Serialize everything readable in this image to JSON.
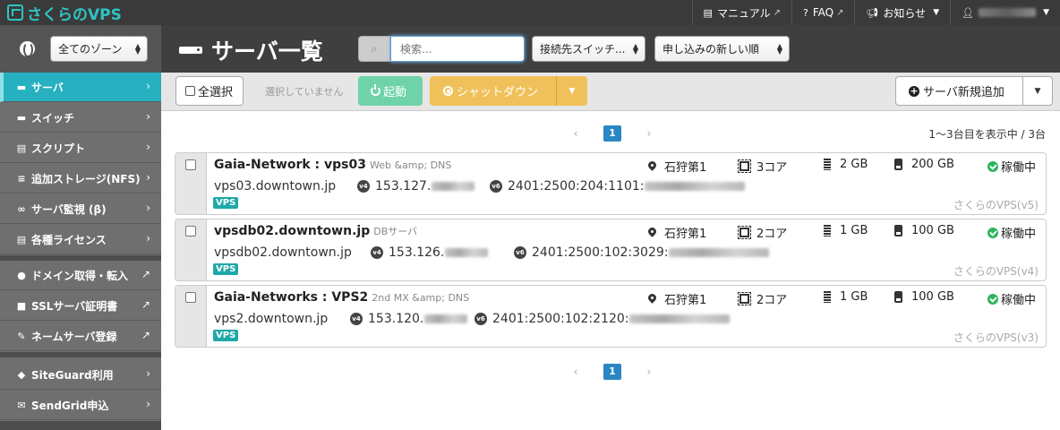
{
  "app": {
    "logo": "さくらのVPS"
  },
  "topnav": {
    "manual": "マニュアル",
    "faq": "FAQ",
    "notice": "お知らせ"
  },
  "sidebar": {
    "zone_select": "全てのゾーン",
    "items": [
      {
        "label": "サーバ",
        "icon": "server-icon",
        "active": true
      },
      {
        "label": "スイッチ",
        "icon": "switch-icon"
      },
      {
        "label": "スクリプト",
        "icon": "script-icon"
      },
      {
        "label": "追加ストレージ(NFS)",
        "icon": "database-icon"
      },
      {
        "label": "サーバ監視 (β)",
        "icon": "binoculars-icon"
      },
      {
        "label": "各種ライセンス",
        "icon": "license-icon"
      },
      {
        "label": "ドメイン取得・転入",
        "icon": "globe-icon"
      },
      {
        "label": "SSLサーバ証明書",
        "icon": "lock-icon"
      },
      {
        "label": "ネームサーバ登録",
        "icon": "edit-icon"
      },
      {
        "label": "SiteGuard利用",
        "icon": "shield-icon"
      },
      {
        "label": "SendGrid申込",
        "icon": "mail-icon"
      }
    ]
  },
  "header": {
    "title": "サーバ一覧",
    "search_placeholder": "検索...",
    "connection_select": "接続先スイッチ...",
    "sort_select": "申し込みの新しい順"
  },
  "toolbar": {
    "select_all": "全選択",
    "selection_status": "選択していません",
    "start": "起動",
    "shutdown": "シャットダウン",
    "add_server": "サーバ新規追加"
  },
  "pagination": {
    "current_page": "1",
    "summary": "1〜3台目を表示中 / 3台"
  },
  "servers": [
    {
      "name": "Gaia-Network : vps03",
      "description": "Web &amp; DNS",
      "location": "石狩第1",
      "cpu": "3コア",
      "memory": "2 GB",
      "disk": "200 GB",
      "status": "稼働中",
      "hostname": "vps03.downtown.jp",
      "ipv4": "153.127.",
      "ipv6": "2401:2500:204:1101:",
      "tag": "VPS",
      "plan": "さくらのVPS(v5)"
    },
    {
      "name": "vpsdb02.downtown.jp",
      "description": "DBサーバ",
      "location": "石狩第1",
      "cpu": "2コア",
      "memory": "1 GB",
      "disk": "100 GB",
      "status": "稼働中",
      "hostname": "vpsdb02.downtown.jp",
      "ipv4": "153.126.",
      "ipv6": "2401:2500:102:3029:",
      "tag": "VPS",
      "plan": "さくらのVPS(v4)"
    },
    {
      "name": "Gaia-Networks : VPS2",
      "description": "2nd MX &amp; DNS",
      "location": "石狩第1",
      "cpu": "2コア",
      "memory": "1 GB",
      "disk": "100 GB",
      "status": "稼働中",
      "hostname": "vps2.downtown.jp",
      "ipv4": "153.120.",
      "ipv6": "2401:2500:102:2120:",
      "tag": "VPS",
      "plan": "さくらのVPS(v3)"
    }
  ],
  "colors": {
    "accent": "#27b0c0",
    "start_button": "#6ed3a9",
    "shutdown_button": "#f0c15a",
    "status_ok": "#2db55d",
    "page_active": "#2a86c4"
  }
}
